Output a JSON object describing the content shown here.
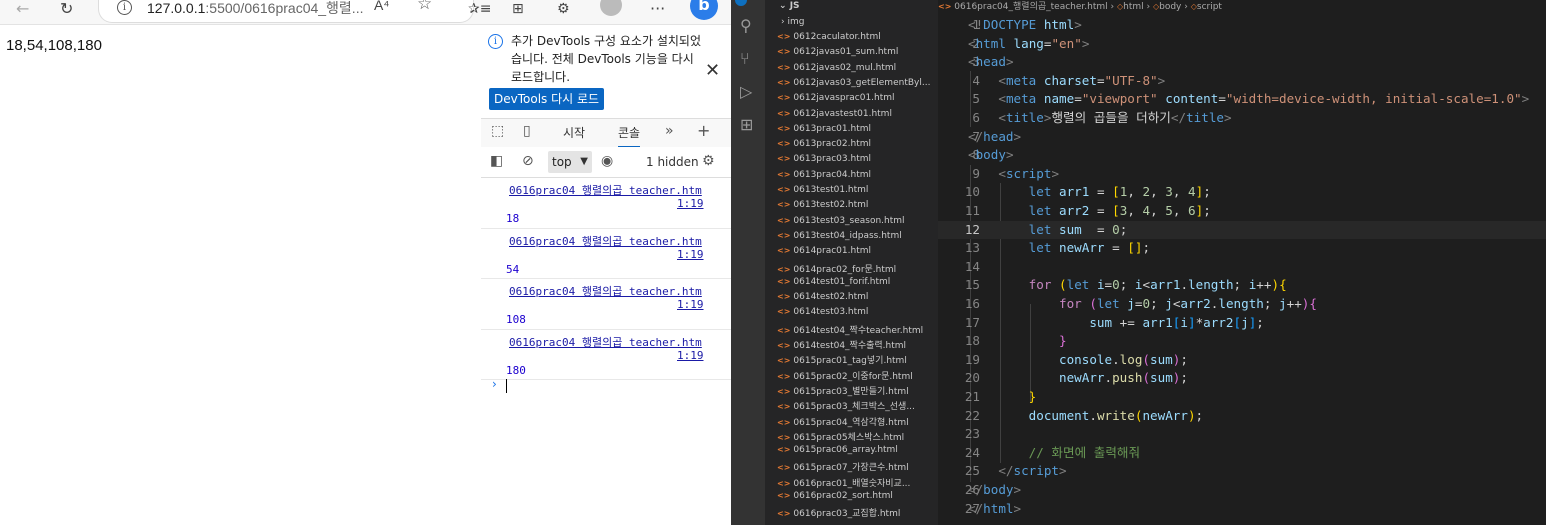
{
  "browser": {
    "url_host": "127.0.0.1",
    "url_rest": ":5500/0616prac04_행렬...",
    "reader_label": "A⁴",
    "page_output": "18,54,108,180"
  },
  "devtools": {
    "notice_text": "추가 DevTools 구성 요소가 설치되었습니다. 전체 DevTools 기능을 다시 로드합니다.",
    "reload_button": "DevTools 다시 로드",
    "tabs": {
      "start": "시작",
      "console": "콘솔"
    },
    "context": "top",
    "hidden_count": "1 hidden",
    "messages": [
      {
        "source": "0616prac04 행렬의곱 teacher.htm",
        "line": "1:19",
        "value": "18"
      },
      {
        "source": "0616prac04 행렬의곱 teacher.htm",
        "line": "1:19",
        "value": "54"
      },
      {
        "source": "0616prac04 행렬의곱 teacher.htm",
        "line": "1:19",
        "value": "108"
      },
      {
        "source": "0616prac04 행렬의곱 teacher.htm",
        "line": "1:19",
        "value": "180"
      }
    ],
    "prompt": "›"
  },
  "explorer": {
    "folder_name": "JS",
    "img_folder": "img",
    "files": [
      "0612caculator.html",
      "0612javas01_sum.html",
      "0612javas02_mul.html",
      "0612javas03_getElementByl...",
      "0612javasprac01.html",
      "0612javastest01.html",
      "0613prac01.html",
      "0613prac02.html",
      "0613prac03.html",
      "0613prac04.html",
      "0613test01.html",
      "0613test02.html",
      "0613test03_season.html",
      "0613test04_idpass.html",
      "0614prac01.html",
      "0614prac02_for문.html",
      "0614test01_forif.html",
      "0614test02.html",
      "0614test03.html",
      "0614test04_짝수teacher.html",
      "0614test04_짝수출력.html",
      "0615prac01_tag넣기.html",
      "0615prac02_이중for문.html",
      "0615prac03_별만들기.html",
      "0615prac03_체크박스_선생...",
      "0615prac04_역삼각형.html",
      "0615prac05체스박스.html",
      "0615prac06_array.html",
      "0615prac07_가장큰수.html",
      "0616prac01_배열숫자비교...",
      "0616prac02_sort.html",
      "0616prac03_교집합.html"
    ]
  },
  "editor": {
    "breadcrumb": [
      "0616prac04_행렬의곱_teacher.html",
      "html",
      "body",
      "script"
    ],
    "current_line": 12,
    "line_numbers": [
      "1",
      "2",
      "3",
      "4",
      "5",
      "6",
      "7",
      "8",
      "9",
      "10",
      "11",
      "12",
      "13",
      "14",
      "15",
      "16",
      "17",
      "18",
      "19",
      "20",
      "21",
      "22",
      "23",
      "24",
      "25",
      "26",
      "27"
    ]
  },
  "icons": {
    "back": "back-arrow-icon",
    "refresh": "refresh-icon",
    "info": "info-icon",
    "favorite": "star-icon",
    "close": "close-icon",
    "search": "search-icon",
    "scm": "source-control-icon",
    "debug": "run-debug-icon",
    "extensions": "extensions-icon",
    "settings": "gear-icon"
  },
  "colors": {
    "accent": "#0a66c2",
    "vscode_bg": "#1e1e1e",
    "html_badge": "#e37933"
  }
}
